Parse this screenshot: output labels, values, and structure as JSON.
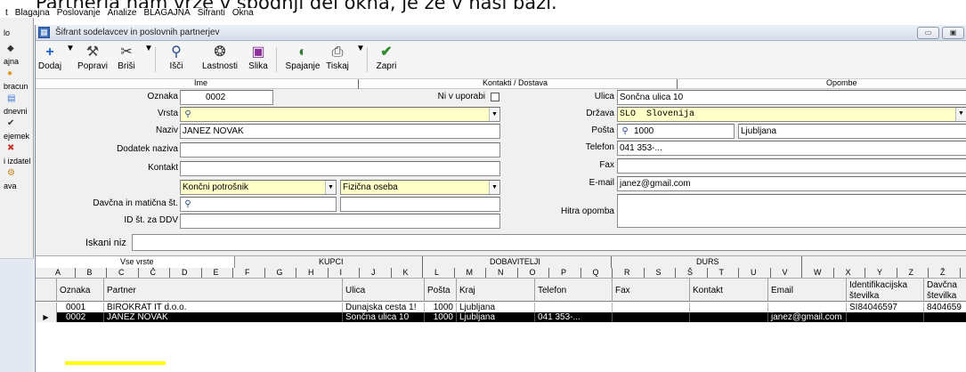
{
  "caption": "Partnerja nam vrže v spodnji del okna, je že v naši bazi.",
  "menu": [
    "t",
    "Blagajna",
    "Poslovanje",
    "Analize",
    "BLAGAJNA",
    "Sifranti",
    "Okna"
  ],
  "sidebar": [
    {
      "label": "lo",
      "icon": "app-icon"
    },
    {
      "label": "ajna",
      "icon": "cashier-icon"
    },
    {
      "label": "bracun",
      "icon": "invoice-icon"
    },
    {
      "label": "dnevni",
      "icon": "daily-icon"
    },
    {
      "label": "ejemek",
      "icon": "receipt-icon"
    },
    {
      "label": "i izdatel",
      "icon": "expense-icon"
    },
    {
      "label": "ava",
      "icon": "settings-icon"
    }
  ],
  "window": {
    "title": "Šifrant sodelavcev in poslovnih partnerjev",
    "buttons": [
      "minimize",
      "maximize"
    ]
  },
  "toolbar": {
    "add": "Dodaj",
    "edit": "Popravi",
    "delete": "Briši",
    "search": "Išči",
    "properties": "Lastnosti",
    "image": "Slika",
    "merge": "Spajanje",
    "print": "Tiskaj",
    "close": "Zapri"
  },
  "sections": {
    "name": "Ime",
    "contacts": "Kontakti / Dostava",
    "notes": "Opombe"
  },
  "form": {
    "oznaka_label": "Oznaka",
    "oznaka": "0002",
    "unused_label": "Ni v uporabi",
    "vrsta_label": "Vrsta",
    "vrsta": "",
    "naziv_label": "Naziv",
    "naziv": "JANEZ NOVAK",
    "dodatek_label": "Dodatek naziva",
    "dodatek": "",
    "kontakt_label": "Kontakt",
    "kontakt": "",
    "type1": "Končni potrošnik",
    "type2": "Fizična oseba",
    "davcna_label": "Davčna in matična št.",
    "davcna": "",
    "maticna": "",
    "ddv_label": "ID št. za DDV",
    "ddv": "",
    "ulica_label": "Ulica",
    "ulica": "Sončna ulica 10",
    "drzava_label": "Država",
    "drzava": "SLO  Slovenija",
    "posta_label": "Pošta",
    "posta": "1000",
    "kraj": "Ljubljana",
    "telefon_label": "Telefon",
    "telefon": "041 353-...",
    "fax_label": "Fax",
    "fax": "",
    "email_label": "E-mail",
    "email": "janez@gmail.com",
    "opomba_label": "Hitra opomba",
    "opomba": ""
  },
  "filter": {
    "label": "Iskani niz",
    "value": ""
  },
  "tabs": [
    "Vse vrste",
    "KUPCI",
    "DOBAVITELJI",
    "DURS"
  ],
  "alphabet": [
    "A",
    "B",
    "C",
    "Č",
    "D",
    "E",
    "F",
    "G",
    "H",
    "I",
    "J",
    "K",
    "L",
    "M",
    "N",
    "O",
    "P",
    "Q",
    "R",
    "S",
    "Š",
    "T",
    "U",
    "V",
    "W",
    "X",
    "Y",
    "Z",
    "Ž",
    "V"
  ],
  "grid": {
    "headers": [
      "Oznaka",
      "Partner",
      "Ulica",
      "Pošta",
      "Kraj",
      "Telefon",
      "Fax",
      "Kontakt",
      "Email",
      "Identifikacijska številka",
      "Davčna številka"
    ],
    "rows": [
      [
        "0001",
        "BIROKRAT IT d.o.o.",
        "Dunajska cesta 1!",
        "1000",
        "Ljubljana",
        "",
        "",
        "",
        "",
        "SI84046597",
        "8404659"
      ],
      [
        "0002",
        "JANEZ NOVAK",
        "Sončna ulica 10",
        "1000",
        "Ljubljana",
        "041 353-...",
        "",
        "",
        "janez@gmail.com",
        "",
        ""
      ]
    ],
    "selected_row": 1
  },
  "colors": {
    "selection": "#000000",
    "highlight": "#ffff00",
    "required_field": "#ffffc8"
  }
}
